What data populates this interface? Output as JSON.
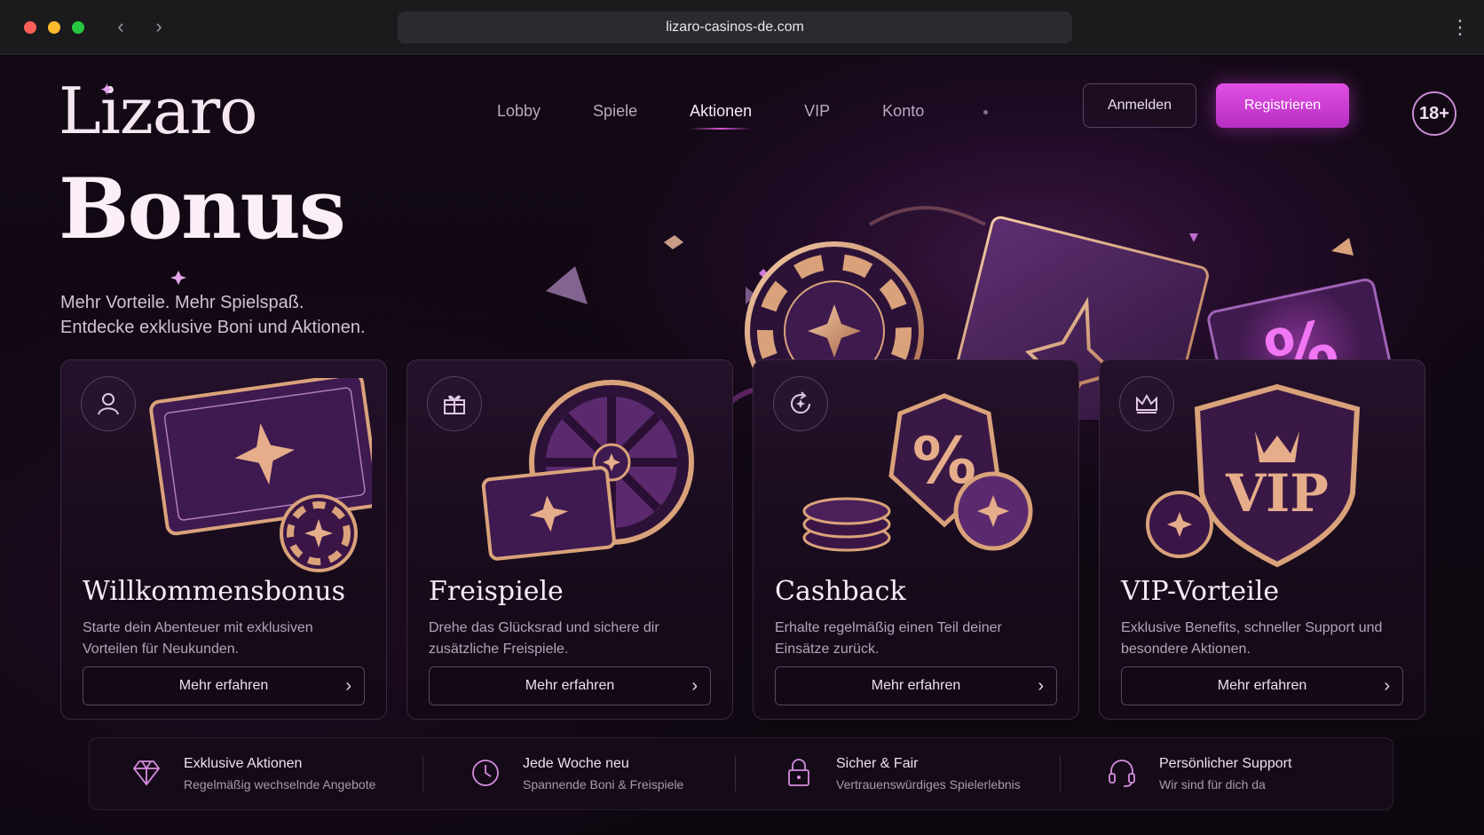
{
  "browser": {
    "url": "lizaro-casinos-de.com"
  },
  "header": {
    "logo": "Lizaro",
    "nav": [
      {
        "label": "Lobby",
        "active": false
      },
      {
        "label": "Spiele",
        "active": false
      },
      {
        "label": "Aktionen",
        "active": true
      },
      {
        "label": "VIP",
        "active": false
      },
      {
        "label": "Konto",
        "active": false
      }
    ],
    "login_label": "Anmelden",
    "register_label": "Registrieren",
    "age_badge": "18+"
  },
  "hero": {
    "title": "Bonus",
    "subtitle_line1": "Mehr Vorteile. Mehr Spielspaß.",
    "subtitle_line2": "Entdecke exklusive Boni und Aktionen."
  },
  "cards": [
    {
      "title": "Willkommensbonus",
      "text": "Starte dein Abenteuer mit exklusiven Vorteilen für Neukunden.",
      "button": "Mehr erfahren",
      "icon": "user-icon"
    },
    {
      "title": "Freispiele",
      "text": "Drehe das Glücksrad und sichere dir zusätzliche Freispiele.",
      "button": "Mehr erfahren",
      "icon": "gift-icon"
    },
    {
      "title": "Cashback",
      "text": "Erhalte regelmäßig einen Teil deiner Einsätze zurück.",
      "button": "Mehr erfahren",
      "icon": "cashback-icon"
    },
    {
      "title": "VIP-Vorteile",
      "text": "Exklusive Benefits, schneller Support und besondere Aktionen.",
      "button": "Mehr erfahren",
      "icon": "crown-icon"
    }
  ],
  "features": [
    {
      "title": "Exklusive Aktionen",
      "sub": "Regelmäßig wechselnde Angebote",
      "icon": "diamond-icon"
    },
    {
      "title": "Jede Woche neu",
      "sub": "Spannende Boni & Freispiele",
      "icon": "clock-icon"
    },
    {
      "title": "Sicher & Fair",
      "sub": "Vertrauenswürdiges Spielerlebnis",
      "icon": "lock-icon"
    },
    {
      "title": "Persönlicher Support",
      "sub": "Wir sind für dich da",
      "icon": "headset-icon"
    }
  ],
  "art_text": {
    "hero_percent": "%",
    "cashback_percent": "%",
    "vip_shield": "VIP"
  },
  "colors": {
    "accent": "#d84fdc",
    "gold": "#d9a27a",
    "purple": "#5b2a6e",
    "background": "#0e0710"
  }
}
